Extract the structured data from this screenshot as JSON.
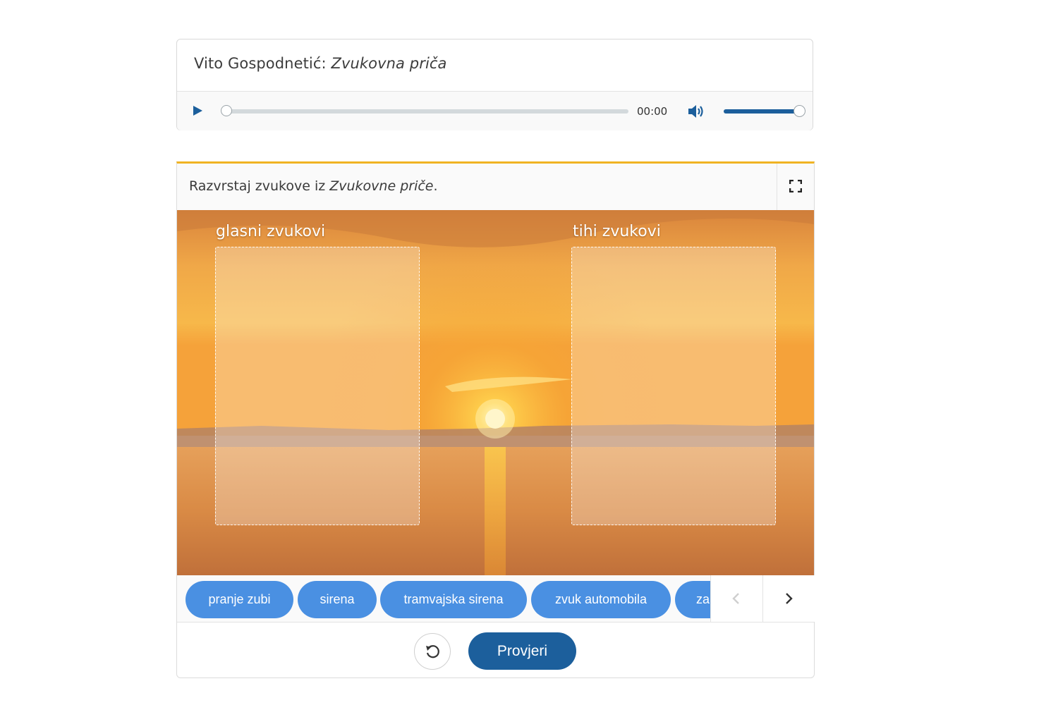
{
  "audio": {
    "author": "Vito Gospodnetić:",
    "work": "Zvukovna priča",
    "time": "00:00",
    "progress": 0,
    "volume": 1.0,
    "icons": {
      "play": "play-icon",
      "volume": "volume-icon"
    }
  },
  "exercise": {
    "title_prefix": "Razvrstaj zvukove iz",
    "title_work": "Zvukovne priče",
    "title_suffix": ".",
    "accent_color": "#f0b323",
    "zones": [
      {
        "label": "glasni zvukovi"
      },
      {
        "label": "tihi zvukovi"
      }
    ],
    "chips": [
      {
        "label": "pranje zubi"
      },
      {
        "label": "sirena"
      },
      {
        "label": "tramvajska sirena"
      },
      {
        "label": "zvuk automobila"
      },
      {
        "label": "za"
      }
    ],
    "chip_color": "#4a90e2",
    "check_label": "Provjeri",
    "check_color": "#1c5f9c",
    "icons": {
      "fullscreen": "fullscreen-icon",
      "prev": "chevron-left-icon",
      "next": "chevron-right-icon",
      "reset": "reset-icon"
    }
  }
}
